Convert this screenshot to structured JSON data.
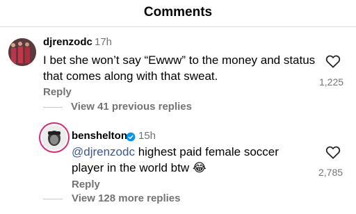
{
  "header": {
    "title": "Comments"
  },
  "comments": [
    {
      "username": "djrenzodc",
      "timestamp": "17h",
      "text": "I bet she won’t say “Ewww” to the money and status that comes along with that sweat.",
      "reply_label": "Reply",
      "likes": "1,225",
      "view_replies": "View 41 previous replies"
    },
    {
      "username": "benshelton",
      "verified": true,
      "timestamp": "15h",
      "mention": "@djrenzodc",
      "text": " highest paid female soccer player in the world btw",
      "emoji": "😂",
      "reply_label": "Reply",
      "likes": "2,785",
      "view_replies": "View 128 more replies"
    }
  ],
  "colors": {
    "mention": "#385898",
    "verified": "#0095f6",
    "secondary_text": "#737373",
    "story_ring": "#d62976"
  },
  "icons": [
    "heart-icon",
    "verified-badge-icon"
  ]
}
